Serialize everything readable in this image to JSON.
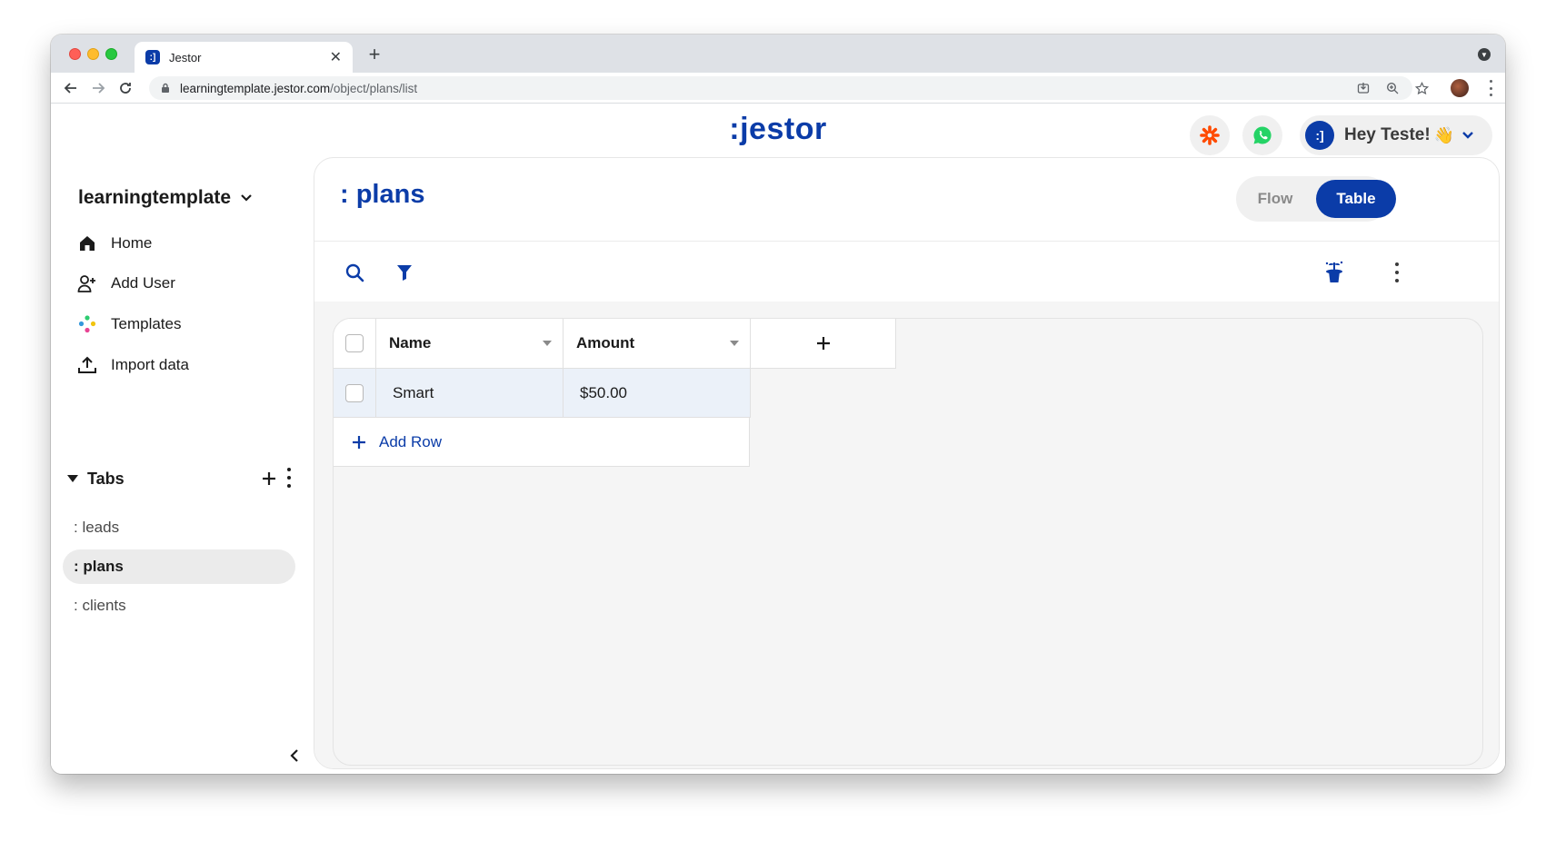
{
  "browser": {
    "tab_title": "Jestor",
    "tab_favicon_text": ":]",
    "url_host": "learningtemplate.jestor.com",
    "url_path": "/object/plans/list"
  },
  "app": {
    "logo": ":jestor",
    "header": {
      "greeting": "Hey Teste!",
      "wave": "👋",
      "avatar_text": ":]"
    },
    "colors": {
      "brand": "#0b3ca8",
      "zapier": "#ff4a00",
      "whatsapp": "#25d366"
    }
  },
  "sidebar": {
    "workspace": "learningtemplate",
    "nav": [
      {
        "label": "Home",
        "icon": "home-icon"
      },
      {
        "label": "Add User",
        "icon": "add-user-icon"
      },
      {
        "label": "Templates",
        "icon": "templates-icon"
      },
      {
        "label": "Import data",
        "icon": "upload-icon"
      }
    ],
    "tabs_label": "Tabs",
    "tabs": [
      {
        "label": ": leads",
        "active": false
      },
      {
        "label": ": plans",
        "active": true
      },
      {
        "label": ": clients",
        "active": false
      }
    ]
  },
  "main": {
    "title": ": plans",
    "view_toggle": {
      "flow": "Flow",
      "table": "Table",
      "selected": "Table"
    },
    "table": {
      "columns": [
        "Name",
        "Amount"
      ],
      "rows": [
        {
          "name": "Smart",
          "amount": "$50.00"
        }
      ],
      "add_row_label": "Add Row"
    }
  }
}
